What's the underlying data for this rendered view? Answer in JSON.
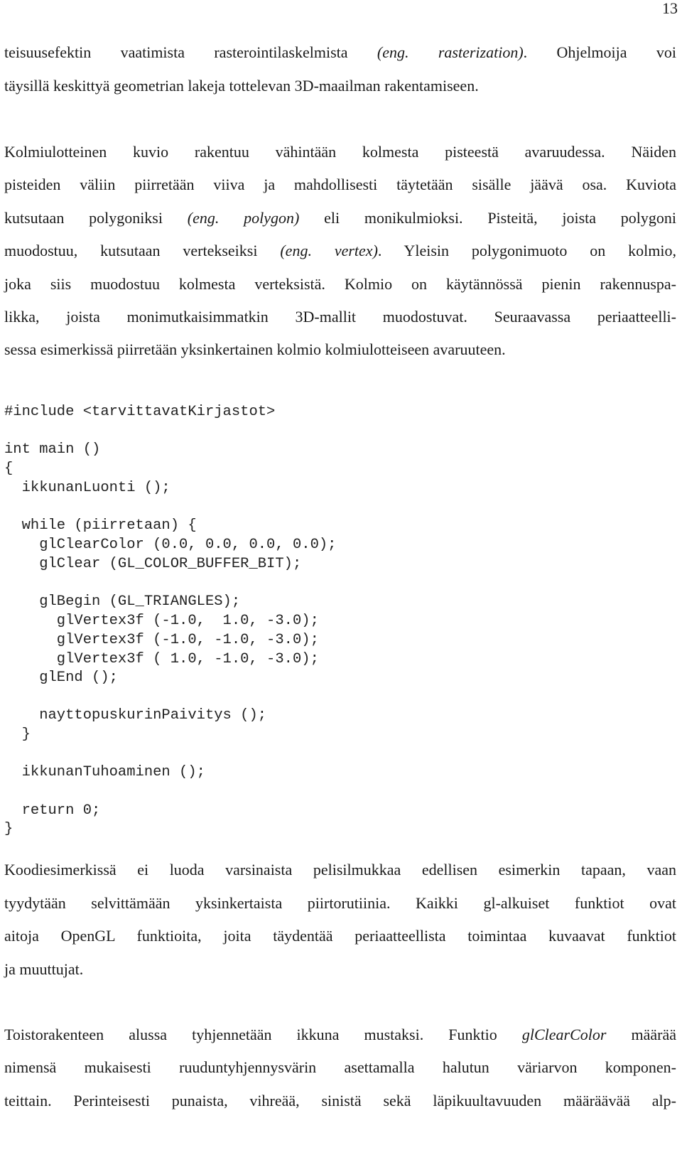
{
  "page": {
    "number": "13"
  },
  "paragraph1": {
    "lines": [
      {
        "parts": [
          {
            "t": "teisuusefektin vaatimista rasterointilaskelmista "
          },
          {
            "t": "(eng. rasterization)",
            "i": true
          },
          {
            "t": ". Ohjelmoija voi"
          }
        ],
        "justify": true
      },
      {
        "parts": [
          {
            "t": "täysillä keskittyä geometrian lakeja tottelevan 3D-maailman rakentamiseen."
          }
        ],
        "justify": false
      }
    ]
  },
  "paragraph2": {
    "lines": [
      {
        "parts": [
          {
            "t": "Kolmiulotteinen kuvio rakentuu vähintään kolmesta pisteestä avaruudessa. Näiden"
          }
        ],
        "justify": true
      },
      {
        "parts": [
          {
            "t": "pisteiden väliin piirretään viiva ja mahdollisesti täytetään sisälle jäävä osa. Kuviota"
          }
        ],
        "justify": true
      },
      {
        "parts": [
          {
            "t": "kutsutaan polygoniksi "
          },
          {
            "t": "(eng. polygon)",
            "i": true
          },
          {
            "t": " eli monikulmioksi. Pisteitä, joista polygoni"
          }
        ],
        "justify": true
      },
      {
        "parts": [
          {
            "t": "muodostuu, kutsutaan vertekseiksi "
          },
          {
            "t": "(eng. vertex)",
            "i": true
          },
          {
            "t": ". Yleisin polygonimuoto on kolmio,"
          }
        ],
        "justify": true
      },
      {
        "parts": [
          {
            "t": "joka siis muodostuu kolmesta verteksistä. Kolmio on käytännössä pienin rakennuspa-"
          }
        ],
        "justify": true
      },
      {
        "parts": [
          {
            "t": "likka, joista monimutkaisimmatkin 3D-mallit muodostuvat. Seuraavassa periaatteelli-"
          }
        ],
        "justify": true
      },
      {
        "parts": [
          {
            "t": "sessa esimerkissä piirretään yksinkertainen kolmio kolmiulotteiseen avaruuteen."
          }
        ],
        "justify": false
      }
    ]
  },
  "code": {
    "lines": [
      "#include <tarvittavatKirjastot>",
      "int main ()",
      "{",
      "  ikkunanLuonti ();",
      "  while (piirretaan) {",
      "    glClearColor (0.0, 0.0, 0.0, 0.0);",
      "    glClear (GL_COLOR_BUFFER_BIT);",
      "    glBegin (GL_TRIANGLES);",
      "      glVertex3f (-1.0,  1.0, -3.0);",
      "      glVertex3f (-1.0, -1.0, -3.0);",
      "      glVertex3f ( 1.0, -1.0, -3.0);",
      "    glEnd ();",
      "    nayttopuskurinPaivitys ();",
      "  }",
      "  ikkunanTuhoaminen ();",
      "  return 0;",
      "}"
    ]
  },
  "paragraph3": {
    "lines": [
      {
        "parts": [
          {
            "t": "Koodiesimerkissä ei luoda varsinaista pelisilmukkaa edellisen esimerkin tapaan, vaan"
          }
        ],
        "justify": true
      },
      {
        "parts": [
          {
            "t": "tyydytään selvittämään yksinkertaista piirtorutiinia. Kaikki gl-alkuiset funktiot ovat"
          }
        ],
        "justify": true
      },
      {
        "parts": [
          {
            "t": "aitoja OpenGL funktioita, joita täydentää periaatteellista toimintaa kuvaavat funktiot"
          }
        ],
        "justify": true
      },
      {
        "parts": [
          {
            "t": "ja muuttujat."
          }
        ],
        "justify": false
      }
    ]
  },
  "paragraph4": {
    "lines": [
      {
        "parts": [
          {
            "t": "Toistorakenteen alussa tyhjennetään ikkuna mustaksi. Funktio "
          },
          {
            "t": "glClearColor",
            "i": true
          },
          {
            "t": " määrää"
          }
        ],
        "justify": true
      },
      {
        "parts": [
          {
            "t": "nimensä mukaisesti ruuduntyhjennysvärin asettamalla halutun väriarvon komponen-"
          }
        ],
        "justify": true
      },
      {
        "parts": [
          {
            "t": "teittain. Perinteisesti punaista, vihreää, sinistä sekä läpikuultavuuden määräävää alp-"
          }
        ],
        "justify": true
      }
    ]
  }
}
